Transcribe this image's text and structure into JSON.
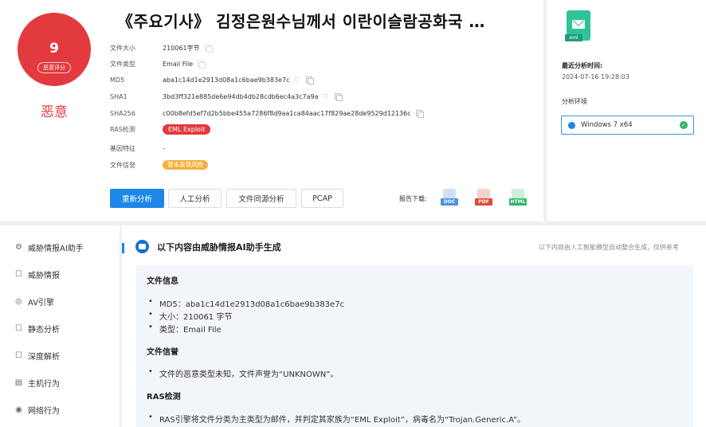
{
  "score": {
    "value": "9",
    "label": "恶意评分",
    "verdict": "恶意",
    "color": "#e23a3f"
  },
  "title": "《주요기사》 김정은원수님께서 이란이슬람공화국 …",
  "details": [
    {
      "label": "文件大小",
      "value": "210061字节"
    },
    {
      "label": "文件类型",
      "value": "Email File"
    },
    {
      "label": "MD5",
      "value": "aba1c14d1e2913d08a1c6bae9b383e7c"
    },
    {
      "label": "SHA1",
      "value": "3bd3ff321e885de6e94db4db28cdb6ec4a3c7a9a"
    },
    {
      "label": "SHA256",
      "value": "c00b8efd5ef7d2b5bbe455a7286f8d9aa1ca84aac17f829ae28de9529d12136c"
    },
    {
      "label": "RAS检测",
      "value": "EML Exploit"
    },
    {
      "label": "基因特征",
      "value": "-"
    },
    {
      "label": "文件信誉",
      "value": "暂未发现风险"
    }
  ],
  "actions": {
    "reanalyze": "重新分析",
    "manual": "人工分析",
    "homology": "文件同源分析",
    "pcap": "PCAP"
  },
  "download": {
    "label": "报告下载:",
    "formats": [
      "DOC",
      "PDF",
      "HTML"
    ],
    "colors": [
      "#4a90e2",
      "#e24a3b",
      "#2fb56a"
    ]
  },
  "file_ext": "eml",
  "side": {
    "last_time_label": "最近分析时间:",
    "last_time": "2024-07-16 19:28:03",
    "env_label": "分析环境",
    "env_value": "Windows 7 x64"
  },
  "nav": [
    {
      "label": "威胁情报AI助手",
      "icon": "ai-icon"
    },
    {
      "label": "威胁情报",
      "icon": "intel-icon"
    },
    {
      "label": "AV引擎",
      "icon": "av-icon"
    },
    {
      "label": "静态分析",
      "icon": "static-icon"
    },
    {
      "label": "深度解析",
      "icon": "deep-icon"
    },
    {
      "label": "主机行为",
      "icon": "host-icon"
    },
    {
      "label": "网络行为",
      "icon": "network-icon"
    }
  ],
  "ai": {
    "title": "以下内容由威胁情报AI助手生成",
    "note": "以下内容由人工智能模型自动整合生成，仅供参考",
    "sections": [
      {
        "heading": "文件信息",
        "bullets": [
          "MD5：aba1c14d1e2913d08a1c6bae9b383e7c",
          "大小：210061 字节",
          "类型：Email File"
        ]
      },
      {
        "heading": "文件信誉",
        "bullets": [
          "文件的恶意类型未知，文件声誉为“UNKNOWN”。"
        ]
      },
      {
        "heading": "RAS检测",
        "bullets": [
          "RAS引擎将文件分类为主类型为邮件，并判定其家族为“EML Exploit”，病毒名为“Trojan.Generic.A”。"
        ]
      }
    ]
  }
}
